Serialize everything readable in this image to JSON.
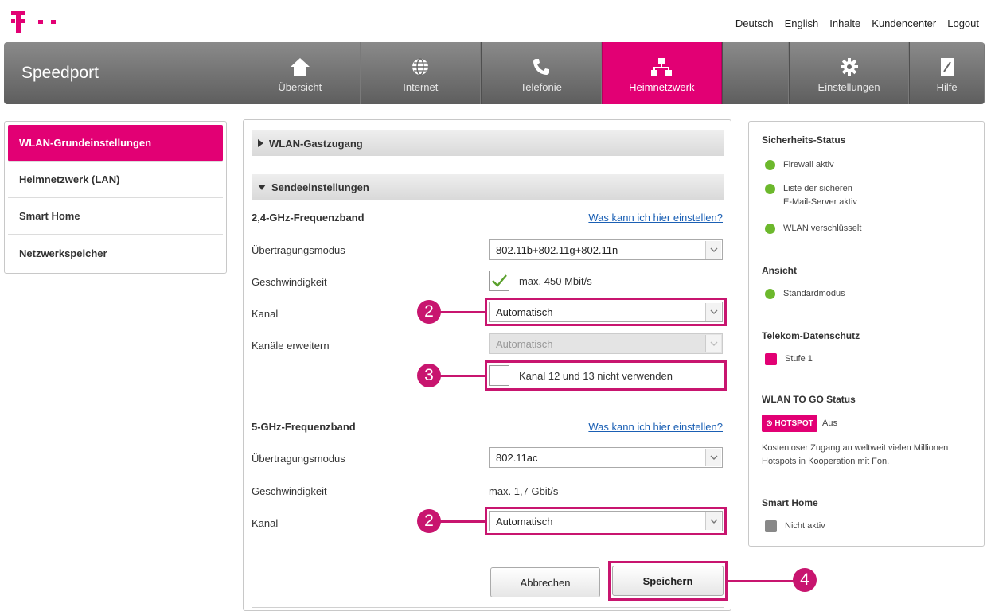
{
  "top_links": [
    "Deutsch",
    "English",
    "Inhalte",
    "Kundencenter",
    "Logout"
  ],
  "nav": {
    "brand": "Speedport",
    "items": [
      {
        "label": "Übersicht",
        "icon": "house-icon"
      },
      {
        "label": "Internet",
        "icon": "globe-icon"
      },
      {
        "label": "Telefonie",
        "icon": "phone-icon"
      },
      {
        "label": "Heimnetzwerk",
        "icon": "network-icon",
        "active": true
      },
      {
        "label": "Einstellungen",
        "icon": "gear-icon"
      },
      {
        "label": "Hilfe",
        "icon": "help-book-icon"
      }
    ]
  },
  "sidebar": {
    "items": [
      {
        "label": "WLAN-Grundeinstellungen",
        "active": true
      },
      {
        "label": "Heimnetzwerk (LAN)"
      },
      {
        "label": "Smart Home"
      },
      {
        "label": "Netzwerkspeicher"
      }
    ]
  },
  "main": {
    "guest_section": "WLAN-Gastzugang",
    "send_section": "Sendeeinstellungen",
    "band24": {
      "title": "2,4-GHz-Frequenzband",
      "help": "Was kann ich hier einstellen?",
      "mode_label": "Übertragungsmodus",
      "mode_value": "802.11b+802.11g+802.11n",
      "speed_label": "Geschwindigkeit",
      "speed_value": "max. 450 Mbit/s",
      "channel_label": "Kanal",
      "channel_value": "Automatisch",
      "extend_label": "Kanäle erweitern",
      "extend_value": "Automatisch",
      "exclude_label": "Kanal 12 und 13 nicht verwenden"
    },
    "band5": {
      "title": "5-GHz-Frequenzband",
      "help": "Was kann ich hier einstellen?",
      "mode_label": "Übertragungsmodus",
      "mode_value": "802.11ac",
      "speed_label": "Geschwindigkeit",
      "speed_value": "max. 1,7 Gbit/s",
      "channel_label": "Kanal",
      "channel_value": "Automatisch"
    },
    "cancel": "Abbrechen",
    "save": "Speichern"
  },
  "markers": {
    "m2": "2",
    "m3": "3",
    "m4": "4"
  },
  "status": {
    "security_title": "Sicherheits-Status",
    "firewall": "Firewall aktiv",
    "safe_mail_1": "Liste der sicheren",
    "safe_mail_2": "E-Mail-Server aktiv",
    "wlan_enc": "WLAN verschlüsselt",
    "view_title": "Ansicht",
    "view_value": "Standardmodus",
    "privacy_title": "Telekom-Datenschutz",
    "privacy_value": "Stufe 1",
    "wlantogo_title": "WLAN TO GO Status",
    "hotspot_badge": "HOTSPOT",
    "hotspot_state": "Aus",
    "hotspot_text": "Kostenloser Zugang an weltweit vielen Millionen Hotspots in Kooperation mit Fon.",
    "smarthome_title": "Smart Home",
    "smarthome_value": "Nicht aktiv"
  },
  "colors": {
    "magenta": "#e20074",
    "marker": "#c8156f",
    "ok_green": "#6cb82c"
  }
}
